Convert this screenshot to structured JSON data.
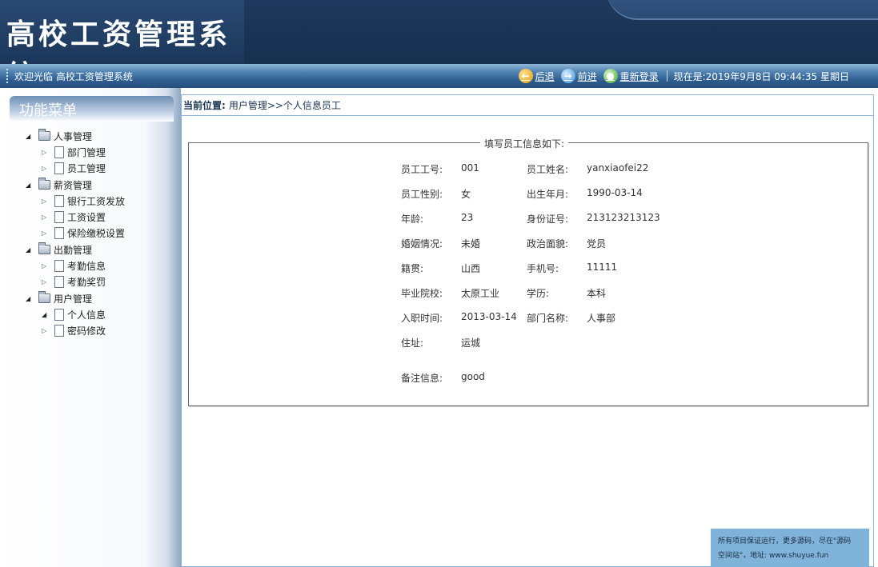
{
  "header": {
    "title": "高校工资管理系统"
  },
  "navbar": {
    "welcome": "欢迎光临 高校工资管理系统",
    "back_label": "后退",
    "forward_label": "前进",
    "relogin_label": "重新登录",
    "datetime": "现在是:2019年9月8日 09:44:35 星期日"
  },
  "sidebar": {
    "menu_title": "功能菜单",
    "groups": [
      {
        "label": "人事管理",
        "items": [
          "部门管理",
          "员工管理"
        ]
      },
      {
        "label": "薪资管理",
        "items": [
          "银行工资发放",
          "工资设置",
          "保险缴税设置"
        ]
      },
      {
        "label": "出勤管理",
        "items": [
          "考勤信息",
          "考勤奖罚"
        ]
      },
      {
        "label": "用户管理",
        "items": [
          "个人信息",
          "密码修改"
        ]
      }
    ]
  },
  "breadcrumb": {
    "prefix": "当前位置:",
    "path": "用户管理>>个人信息员工"
  },
  "form": {
    "legend": "填写员工信息如下:",
    "rows": [
      {
        "l1": "员工工号:",
        "v1": "001",
        "l2": "员工姓名:",
        "v2": "yanxiaofei22"
      },
      {
        "l1": "员工性别:",
        "v1": "女",
        "l2": "出生年月:",
        "v2": "1990-03-14"
      },
      {
        "l1": "年龄:",
        "v1": "23",
        "l2": "身份证号:",
        "v2": "213123213123"
      },
      {
        "l1": "婚姻情况:",
        "v1": "未婚",
        "l2": "政治面貌:",
        "v2": "党员"
      },
      {
        "l1": "籍贯:",
        "v1": "山西",
        "l2": "手机号:",
        "v2": "11111"
      },
      {
        "l1": "毕业院校:",
        "v1": "太原工业",
        "l2": "学历:",
        "v2": "本科"
      },
      {
        "l1": "入职时间:",
        "v1": "2013-03-14",
        "l2": "部门名称:",
        "v2": "人事部"
      }
    ],
    "address_label": "住址:",
    "address_value": "运城",
    "remark_label": "备注信息:",
    "remark_value": "good"
  },
  "watermark": {
    "line1": "所有项目保证运行，更多源码，尽在\"源码",
    "line2": "空间站\"，地址: www.shuyue.fun"
  }
}
